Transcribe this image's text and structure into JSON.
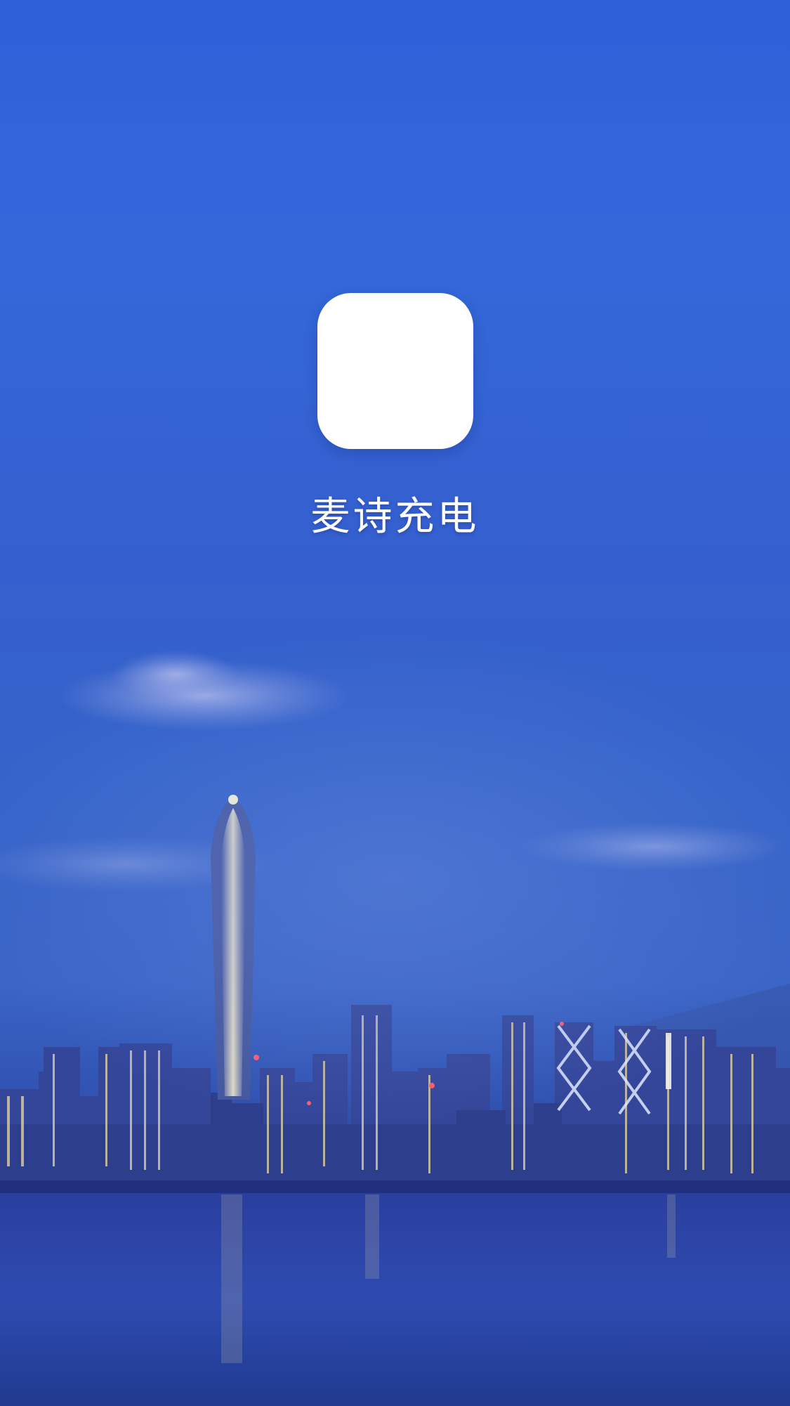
{
  "app": {
    "name": "麦诗充电",
    "logo_icon": "sound-wave-icon"
  },
  "colors": {
    "sky_top": "#2f5fd9",
    "sky_bottom": "#25429a",
    "logo_bg": "#ffffff",
    "logo_wave_start": "#3b4de0",
    "logo_wave_end": "#29d3f2",
    "text": "#ffffff"
  },
  "background": {
    "scene": "city-skyline-at-dusk"
  }
}
